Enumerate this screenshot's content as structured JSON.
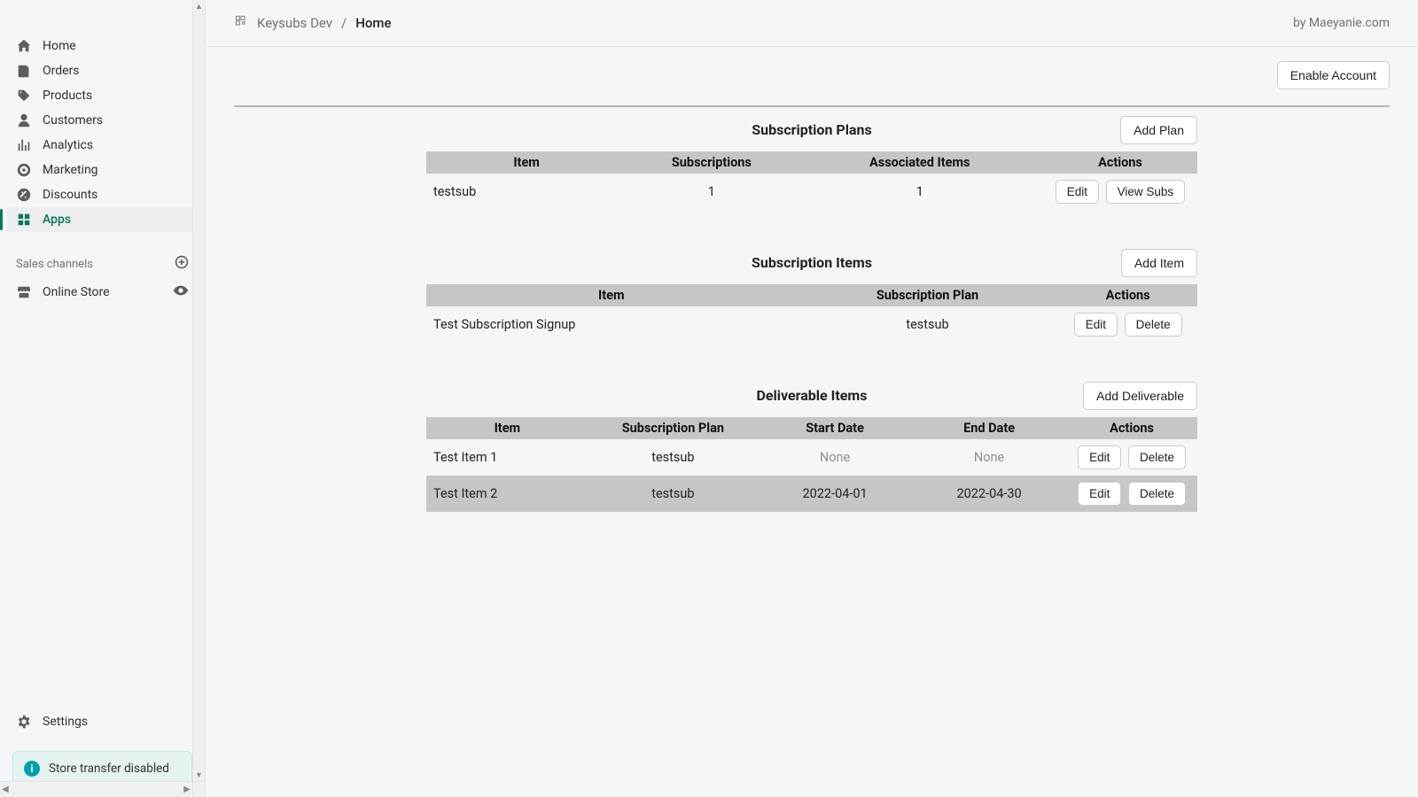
{
  "sidebar": {
    "items": [
      {
        "label": "Home"
      },
      {
        "label": "Orders"
      },
      {
        "label": "Products"
      },
      {
        "label": "Customers"
      },
      {
        "label": "Analytics"
      },
      {
        "label": "Marketing"
      },
      {
        "label": "Discounts"
      },
      {
        "label": "Apps"
      }
    ],
    "channels_header": "Sales channels",
    "channels": [
      {
        "label": "Online Store"
      }
    ],
    "settings_label": "Settings",
    "notice": "Store transfer disabled"
  },
  "topbar": {
    "breadcrumb_app": "Keysubs Dev",
    "breadcrumb_sep": "/",
    "breadcrumb_page": "Home",
    "brand": "by Maeyanie.com"
  },
  "actions": {
    "enable_account": "Enable Account"
  },
  "plans": {
    "title": "Subscription Plans",
    "add_label": "Add Plan",
    "headers": {
      "item": "Item",
      "subscriptions": "Subscriptions",
      "associated": "Associated Items",
      "actions": "Actions"
    },
    "rows": [
      {
        "item": "testsub",
        "subscriptions": "1",
        "associated": "1",
        "edit": "Edit",
        "view": "View Subs"
      }
    ]
  },
  "items": {
    "title": "Subscription Items",
    "add_label": "Add Item",
    "headers": {
      "item": "Item",
      "plan": "Subscription Plan",
      "actions": "Actions"
    },
    "rows": [
      {
        "item": "Test Subscription Signup",
        "plan": "testsub",
        "edit": "Edit",
        "delete": "Delete"
      }
    ]
  },
  "deliverables": {
    "title": "Deliverable Items",
    "add_label": "Add Deliverable",
    "headers": {
      "item": "Item",
      "plan": "Subscription Plan",
      "start": "Start Date",
      "end": "End Date",
      "actions": "Actions"
    },
    "rows": [
      {
        "item": "Test Item 1",
        "plan": "testsub",
        "start": "None",
        "end": "None",
        "start_muted": true,
        "end_muted": true,
        "edit": "Edit",
        "delete": "Delete"
      },
      {
        "item": "Test Item 2",
        "plan": "testsub",
        "start": "2022-04-01",
        "end": "2022-04-30",
        "start_muted": false,
        "end_muted": false,
        "edit": "Edit",
        "delete": "Delete"
      }
    ]
  }
}
